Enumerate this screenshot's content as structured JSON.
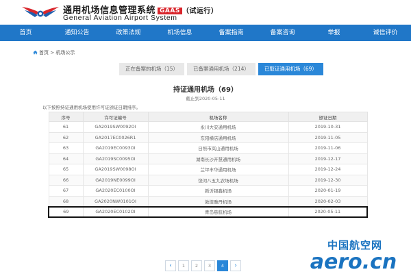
{
  "header": {
    "title": "通用机场信息管理系统",
    "badge": "GAAS",
    "trial": "（试运行）",
    "subtitle": "General Aviation Airport System"
  },
  "nav": [
    "首页",
    "通知公告",
    "政策法规",
    "机场信息",
    "备案指南",
    "备案咨询",
    "举报",
    "诚信评价"
  ],
  "breadcrumb": {
    "home": "首页",
    "sep": ">",
    "current": "机场公示"
  },
  "tabs": [
    {
      "label": "正在备案的机场（15）",
      "active": false
    },
    {
      "label": "已备案通用机场（214）",
      "active": false
    },
    {
      "label": "已取证通用机场（69）",
      "active": true
    }
  ],
  "page": {
    "title": "持证通用机场（69）",
    "cutoff": "截止到2020-05-11",
    "sort_note": "以下按照持证通用机场使用许可证颁证日期排序。"
  },
  "table": {
    "headers": [
      "序号",
      "许可证编号",
      "机场名称",
      "颁证日期"
    ],
    "rows": [
      [
        "61",
        "GA2019SW0092OI",
        "永川大安通用机场",
        "2019-10-31"
      ],
      [
        "62",
        "GA2017EC0026R1",
        "东阳横店通用机场",
        "2019-11-05"
      ],
      [
        "63",
        "GA2019EC0093OI",
        "日照市岚山通用机场",
        "2019-11-06"
      ],
      [
        "64",
        "GA2019SC0095OI",
        "湖南长沙开慧通用机场",
        "2019-12-17"
      ],
      [
        "65",
        "GA2019SW0098OI",
        "兰坪丰华通用机场",
        "2019-12-24"
      ],
      [
        "66",
        "GA2019NE0099OI",
        "饶河八五九农场机场",
        "2019-12-30"
      ],
      [
        "67",
        "GA2020EC0100OI",
        "新沂银鑫机场",
        "2020-01-19"
      ],
      [
        "68",
        "GA2020NW0101OI",
        "敦煌雅丹机场",
        "2020-02-03"
      ],
      [
        "69",
        "GA2020EC0102OI",
        "青岛慈航机场",
        "2020-05-11"
      ]
    ],
    "highlighted_row": 8
  },
  "pager": {
    "prev": "‹",
    "pages": [
      "1",
      "2",
      "3",
      "4"
    ],
    "current": "4",
    "next": "›"
  },
  "watermark": {
    "cn": "中国航空网",
    "en": "aero.cn"
  },
  "colors": {
    "nav": "#2077c8",
    "accent": "#2a87d8",
    "badge": "#d9262c",
    "watermark": "#1a73c0"
  }
}
